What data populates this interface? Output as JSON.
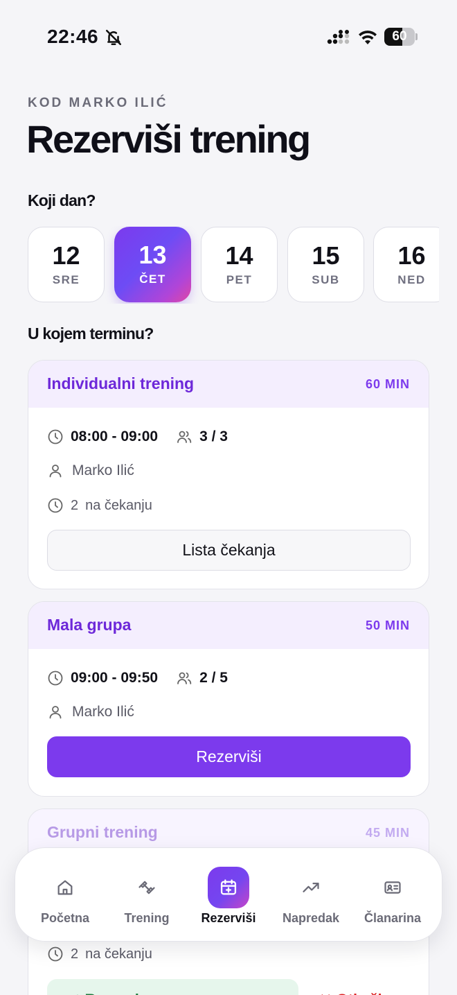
{
  "status_bar": {
    "time": "22:46",
    "battery": "60",
    "battery_level": 0.6
  },
  "header": {
    "eyebrow": "KOD MARKO ILIĆ",
    "title": "Rezerviši trening"
  },
  "day_picker": {
    "question": "Koji dan?",
    "days": [
      {
        "num": "12",
        "dow": "SRE",
        "selected": false
      },
      {
        "num": "13",
        "dow": "ČET",
        "selected": true
      },
      {
        "num": "14",
        "dow": "PET",
        "selected": false
      },
      {
        "num": "15",
        "dow": "SUB",
        "selected": false
      },
      {
        "num": "16",
        "dow": "NED",
        "selected": false
      }
    ]
  },
  "slot_picker": {
    "question": "U kojem terminu?"
  },
  "sessions": [
    {
      "name": "Individualni trening",
      "duration": "60 MIN",
      "time": "08:00 - 09:00",
      "capacity": "3 / 3",
      "trainer": "Marko Ilić",
      "waiting_count": "2",
      "waiting_label": "na čekanju",
      "action_label": "Lista čekanja"
    },
    {
      "name": "Mala grupa",
      "duration": "50 MIN",
      "time": "09:00 - 09:50",
      "capacity": "2 / 5",
      "trainer": "Marko Ilić",
      "action_label": "Rezerviši"
    },
    {
      "name": "Grupni trening",
      "duration": "45 MIN",
      "waiting_count": "2",
      "waiting_label": "na čekanju",
      "confirm_label": "✓ Rezervisano",
      "cancel_label": "✕ Otkaži"
    }
  ],
  "tab_bar": {
    "tabs": [
      {
        "label": "Početna",
        "icon": "home-icon"
      },
      {
        "label": "Trening",
        "icon": "dumbbell-icon"
      },
      {
        "label": "Rezerviši",
        "icon": "calendar-plus-icon",
        "active": true
      },
      {
        "label": "Napredak",
        "icon": "trending-up-icon"
      },
      {
        "label": "Članarina",
        "icon": "id-card-icon"
      }
    ]
  },
  "colors": {
    "accent": "#7c3aed",
    "accent_text": "#6d28d9",
    "card_header_bg": "#f4eefe",
    "background": "#f5f5f8"
  }
}
